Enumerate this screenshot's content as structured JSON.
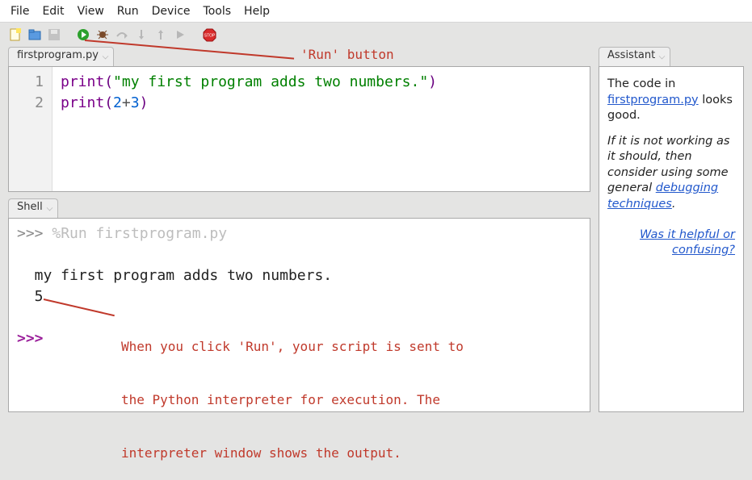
{
  "menu": {
    "file": "File",
    "edit": "Edit",
    "view": "View",
    "run": "Run",
    "device": "Device",
    "tools": "Tools",
    "help": "Help"
  },
  "toolbar_icons": {
    "new": "new-file-icon",
    "open": "open-file-icon",
    "save": "save-icon",
    "run": "run-icon",
    "debug": "debug-icon",
    "step_over": "step-over-icon",
    "step_into": "step-into-icon",
    "step_out": "step-out-icon",
    "resume": "resume-icon",
    "stop": "stop-icon"
  },
  "editor": {
    "tab_label": "firstprogram.py",
    "lines": [
      {
        "n": "1",
        "func": "print",
        "lparen": "(",
        "str": "\"my first program adds two numbers.\"",
        "rparen": ")"
      },
      {
        "n": "2",
        "func": "print",
        "lparen": "(",
        "num_a": "2",
        "op": "+",
        "num_b": "3",
        "rparen": ")"
      }
    ]
  },
  "shell": {
    "tab_label": "Shell",
    "prompt": ">>> ",
    "run_cmd": "%Run firstprogram.py",
    "out_line1": "  my first program adds two numbers.",
    "out_line2": "  5",
    "prompt2": ">>> "
  },
  "assistant": {
    "tab_label": "Assistant",
    "pre_text": "The code in ",
    "file_link": "firstprogram.py",
    "post_text": " looks good.",
    "italic_pre": "If it is not working as it should, then consider using some general ",
    "italic_link": "debugging techniques",
    "italic_post": ".",
    "helpful": "Was it helpful or confusing?"
  },
  "annotations": {
    "run_label": "'Run' button",
    "shell_note_l1": "When you click 'Run', your script is sent to",
    "shell_note_l2": "the Python interpreter for execution. The",
    "shell_note_l3": "interpreter window shows the output."
  }
}
